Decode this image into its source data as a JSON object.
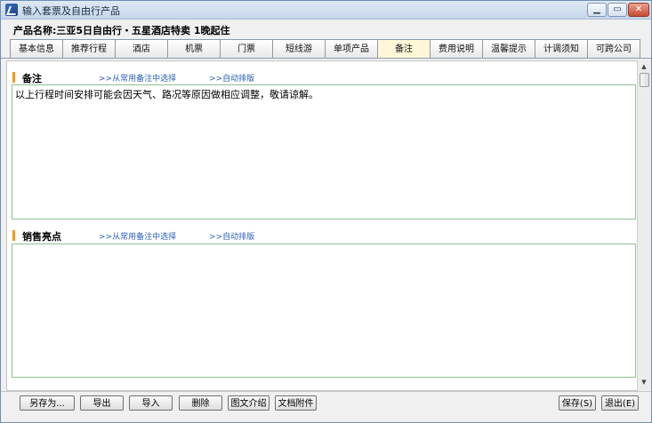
{
  "window": {
    "title": "输入套票及自由行产品"
  },
  "product": {
    "label": "产品名称:",
    "name": "三亚5日自由行・五星酒店特卖 1晚起住"
  },
  "tabs": [
    {
      "label": "基本信息"
    },
    {
      "label": "推荐行程"
    },
    {
      "label": "酒店"
    },
    {
      "label": "机票"
    },
    {
      "label": "门票"
    },
    {
      "label": "短线游"
    },
    {
      "label": "单项产品"
    },
    {
      "label": "备注"
    },
    {
      "label": "费用说明"
    },
    {
      "label": "温馨提示"
    },
    {
      "label": "计调须知"
    },
    {
      "label": "可跨公司"
    }
  ],
  "active_tab": "备注",
  "sections": {
    "remarks": {
      "title": "备注",
      "link_select": ">>从常用备注中选择",
      "link_format": ">>自动排版",
      "text": "以上行程时间安排可能会因天气、路况等原因做相应调整，敬请谅解。"
    },
    "highlights": {
      "title": "销售亮点",
      "link_select": ">>从常用备注中选择",
      "link_format": ">>自动排版",
      "text": ""
    }
  },
  "buttons": {
    "save_as": "另存为...",
    "export": "导出",
    "import": "导入",
    "delete": "删除",
    "image_text": "图文介绍",
    "attachment": "文档附件",
    "save": "保存(S)",
    "exit": "退出(E)"
  },
  "colors": {
    "accent_bar": "#f39a1e",
    "link": "#2d5fb8",
    "active_tab": "#fff7d8"
  }
}
